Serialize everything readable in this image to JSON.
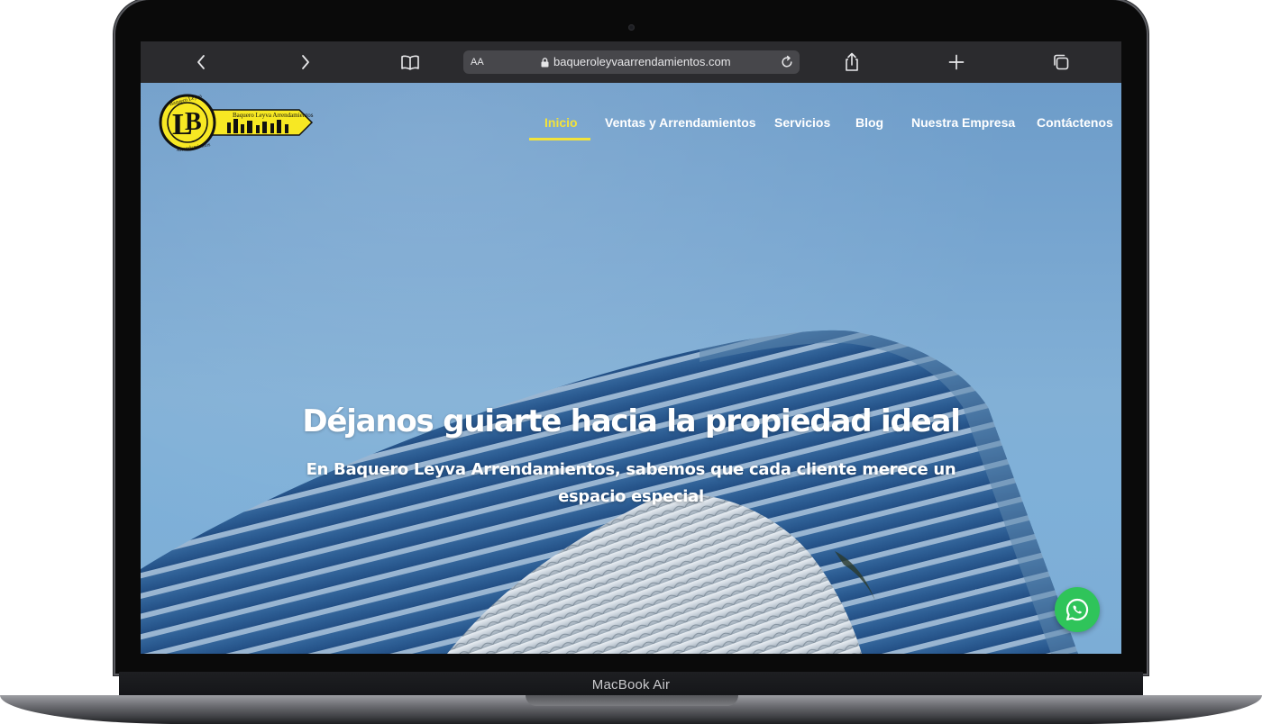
{
  "device": {
    "model_label": "MacBook Air"
  },
  "browser": {
    "text_size_label": "AA",
    "url": "baqueroleyvaarrendamientos.com"
  },
  "site": {
    "logo": {
      "brand_top": "Baquero Leyva",
      "brand_bottom": "Arrendamientos",
      "brand_line": "Baquero Leyva Arrendamientos",
      "colors": {
        "yellow": "#f7e823",
        "black": "#111111"
      }
    },
    "nav": [
      {
        "label": "Inicio",
        "active": true
      },
      {
        "label": "Ventas y Arrendamientos",
        "active": false
      },
      {
        "label": "Servicios",
        "active": false
      },
      {
        "label": "Blog",
        "active": false
      },
      {
        "label": "Nuestra Empresa",
        "active": false
      },
      {
        "label": "Contáctenos",
        "active": false
      }
    ],
    "hero": {
      "title": "Déjanos guiarte hacia la propiedad ideal",
      "subtitle": "En Baquero Leyva Arrendamientos, sabemos que cada cliente merece un espacio especial"
    },
    "floating": {
      "icon": "whatsapp-icon",
      "color": "#2fc45a"
    },
    "accent_color": "#f2e33a"
  }
}
